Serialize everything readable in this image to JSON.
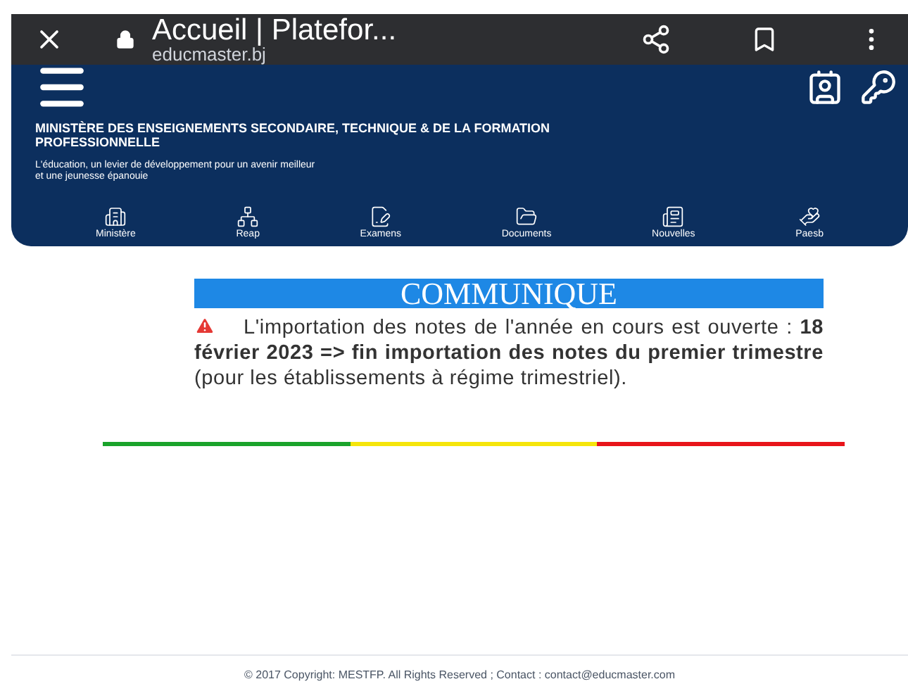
{
  "browser": {
    "title": "Accueil | Platefor...",
    "url": "educmaster.bj"
  },
  "header": {
    "ministry": "MINISTÈRE DES ENSEIGNEMENTS SECONDAIRE, TECHNIQUE & DE LA FORMATION PROFESSIONNELLE",
    "slogan": "L'éducation, un levier de développement pour un avenir meilleur et une jeunesse épanouie"
  },
  "nav": [
    {
      "label": "Ministère",
      "kind": "building"
    },
    {
      "label": "Reap",
      "kind": "network"
    },
    {
      "label": "Examens",
      "kind": "exam"
    },
    {
      "label": "Documents",
      "kind": "folder"
    },
    {
      "label": "Nouvelles",
      "kind": "news"
    },
    {
      "label": "Paesb",
      "kind": "hands"
    }
  ],
  "notice": {
    "title": "COMMUNIQUE",
    "text": "L'importation des notes de l'année en cours est ouverte : **18 février 2023 => fin importation des notes du premier trimestre** (pour les établissements à régime trimestriel)."
  },
  "divider_colors": [
    {
      "color": "#1aa32a"
    },
    {
      "color": "#f5e50a"
    },
    {
      "color": "#e8141a"
    }
  ],
  "footer": "© 2017 Copyright: MESTFP. All Rights Reserved ; Contact : contact@educmaster.com"
}
